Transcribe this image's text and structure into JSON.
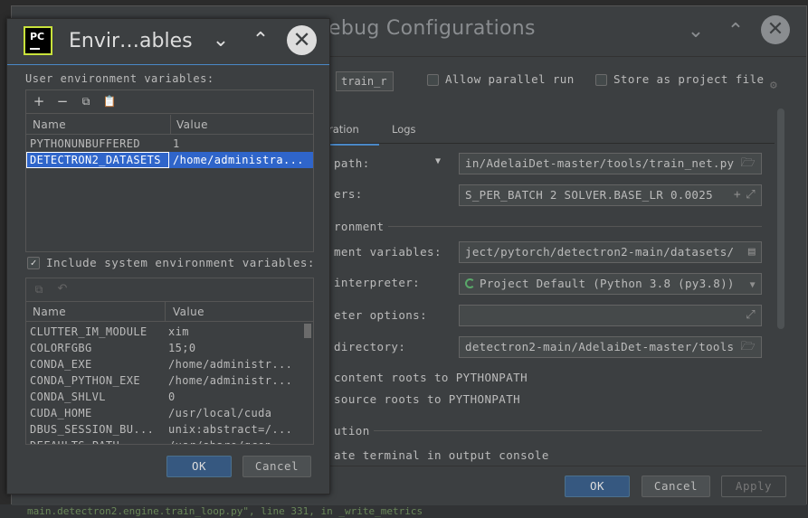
{
  "background": {
    "bottom_text": "main.detectron2.engine.train_loop.py\", line 331, in _write_metrics"
  },
  "main_window": {
    "title": "Run/Debug Configurations",
    "title_visible": "ebug Configurations",
    "name_value": "train_r",
    "allow_parallel_label": "Allow parallel run",
    "store_project_label": "Store as project file",
    "tabs": [
      {
        "label": "ration",
        "active": true
      },
      {
        "label": "Logs",
        "active": false
      }
    ],
    "fields": [
      {
        "label": "path:",
        "value": "in/AdelaiDet-master/tools/train_net.py"
      },
      {
        "label": "ers:",
        "value": "S_PER_BATCH 2 SOLVER.BASE_LR 0.0025"
      },
      {
        "label": "ment variables:",
        "value": "ject/pytorch/detectron2-main/datasets/"
      },
      {
        "label": "interpreter:",
        "value": "Project Default (Python 3.8 (py3.8))"
      },
      {
        "label": "eter options:",
        "value": ""
      },
      {
        "label": " directory:",
        "value": "detectron2-main/AdelaiDet-master/tools"
      }
    ],
    "section_environment": "ronment",
    "content_roots_label": "content roots to PYTHONPATH",
    "source_roots_label": "source roots to PYTHONPATH",
    "section_execution": "ution",
    "emulate_terminal_label": "ate terminal in output console",
    "buttons": {
      "ok": "OK",
      "cancel": "Cancel",
      "apply": "Apply"
    }
  },
  "env_dialog": {
    "title": "Envir…ables",
    "user_vars_label": "User environment variables:",
    "columns": {
      "name": "Name",
      "value": "Value"
    },
    "user_vars": [
      {
        "name": "PYTHONUNBUFFERED",
        "value": "1",
        "selected": false
      },
      {
        "name": "DETECTRON2_DATASETS",
        "value": "/home/administra...",
        "selected": true
      }
    ],
    "include_system_label": "Include system environment variables:",
    "include_system_checked": true,
    "system_vars": [
      {
        "name": "CLUTTER_IM_MODULE",
        "value": "xim"
      },
      {
        "name": "COLORFGBG",
        "value": "15;0"
      },
      {
        "name": "CONDA_EXE",
        "value": "/home/administr..."
      },
      {
        "name": "CONDA_PYTHON_EXE",
        "value": "/home/administr..."
      },
      {
        "name": "CONDA_SHLVL",
        "value": "0"
      },
      {
        "name": "CUDA_HOME",
        "value": "/usr/local/cuda"
      },
      {
        "name": "DBUS_SESSION_BU...",
        "value": "unix:abstract=/..."
      },
      {
        "name": "DEFAULTS_PATH",
        "value": "/usr/share/gcon..."
      }
    ],
    "buttons": {
      "ok": "OK",
      "cancel": "Cancel"
    }
  },
  "colors": {
    "accent": "#4a88c7",
    "selection": "#2f65ca",
    "primary_button": "#365880",
    "window_bg": "#3c3f41",
    "logo_green": "#c8e23b"
  }
}
